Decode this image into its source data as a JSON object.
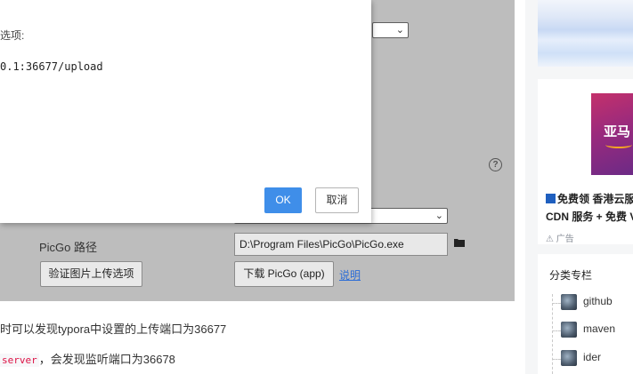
{
  "dialog": {
    "label": "选项:",
    "value": "0.1:36677/upload",
    "ok_label": "OK",
    "cancel_label": "取消"
  },
  "settings": {
    "picgo_path_label": "PicGo 路径",
    "picgo_path_value": "D:\\Program Files\\PicGo\\PicGo.exe",
    "verify_button": "验证图片上传选项",
    "download_button": "下载 PicGo (app)",
    "help_link": "说明"
  },
  "article": {
    "line1": "时可以发现typora中设置的上传端口为36677",
    "line2_code": "server",
    "line2_text": "，会发现监听端口为36678"
  },
  "ad": {
    "image_text": "亚马",
    "title": "免费领 香港云服务",
    "subtitle": "CDN 服务 + 免费 V",
    "tag": "广告"
  },
  "categories": {
    "title": "分类专栏",
    "items": [
      "github",
      "maven",
      "ider"
    ]
  },
  "colors": {
    "primary_button": "#3f8ee9",
    "link": "#2b6cd6",
    "code_text": "#dd1144"
  }
}
